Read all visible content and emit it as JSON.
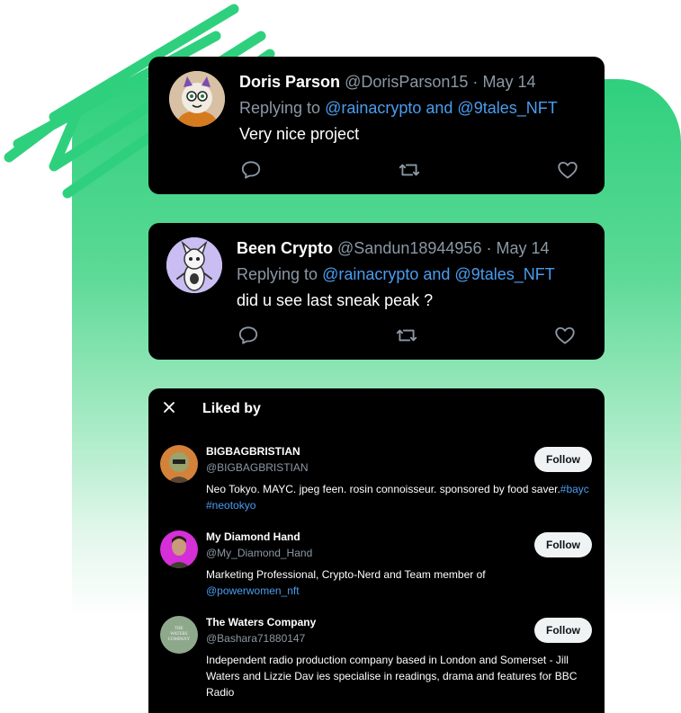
{
  "tweets": [
    {
      "name": "Doris Parson",
      "handle": "@DorisParson15",
      "separator": "·",
      "date": "May 14",
      "replying_prefix": "Replying to",
      "replying_to": "@rainacrypto and @9tales_NFT",
      "text": "Very nice project"
    },
    {
      "name": "Been Crypto",
      "handle": "@Sandun18944956",
      "separator": "·",
      "date": "May 14",
      "replying_prefix": "Replying to",
      "replying_to": "@rainacrypto and @9tales_NFT",
      "text": "did u see last sneak peak ?"
    }
  ],
  "liked_by": {
    "title": "Liked by",
    "follow_label": "Follow",
    "users": [
      {
        "name": "BIGBAGBRISTIAN",
        "handle": "@BIGBAGBRISTIAN",
        "bio": "Neo Tokyo. MAYC. jpeg feen. rosin connoisseur. sponsored by food saver.",
        "bio_link": "#bayc #neotokyo"
      },
      {
        "name": "My Diamond Hand",
        "handle": "@My_Diamond_Hand",
        "bio": "Marketing Professional, Crypto-Nerd and Team member of",
        "bio_link": "@powerwomen_nft"
      },
      {
        "name": "The Waters Company",
        "handle": "@Bashara71880147",
        "bio": "Independent radio production company based in London and Somerset - Jill Waters and Lizzie Dav ies specialise in readings, drama and features for BBC Radio",
        "bio_link": "",
        "avatar_text": "THE WATERS COMPANY"
      }
    ]
  },
  "colors": {
    "accent_green": "#2fd07d",
    "mention_blue": "#4a9df0",
    "card_bg": "#000000"
  }
}
